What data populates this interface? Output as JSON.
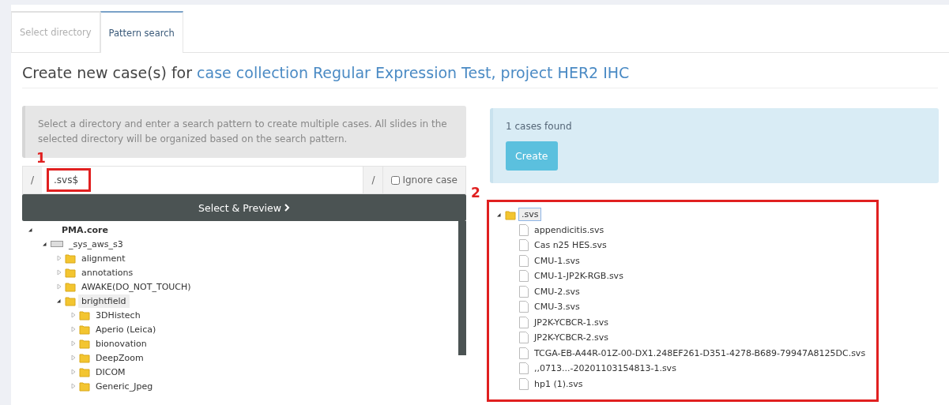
{
  "tabs": [
    {
      "label": "Select directory",
      "selected": false
    },
    {
      "label": "Pattern search",
      "selected": true
    }
  ],
  "heading": {
    "prefix": "Create new case(s) for",
    "link": "case collection Regular Expression Test, project HER2 IHC"
  },
  "info": "Select a directory and enter a search pattern to create multiple cases. All slides in the selected directory will be organized based on the search pattern.",
  "pattern": {
    "open_delimiter": "/",
    "value": ".svs$",
    "close_delimiter": "/",
    "callout": "1"
  },
  "ignore_case": {
    "label": "Ignore case",
    "checked": false
  },
  "preview_button": "Select & Preview",
  "directory_tree": [
    {
      "label": "PMA.core",
      "kind": "root",
      "expanded": true,
      "selected": false,
      "children": [
        {
          "label": "_sys_aws_s3",
          "kind": "drive",
          "expanded": true,
          "selected": false,
          "children": [
            {
              "label": "alignment",
              "kind": "folder",
              "expanded": false,
              "selected": false
            },
            {
              "label": "annotations",
              "kind": "folder",
              "expanded": false,
              "selected": false
            },
            {
              "label": "AWAKE(DO_NOT_TOUCH)",
              "kind": "folder",
              "expanded": false,
              "selected": false
            },
            {
              "label": "brightfield",
              "kind": "folder",
              "expanded": true,
              "selected": true,
              "children": [
                {
                  "label": "3DHistech",
                  "kind": "folder",
                  "expanded": false,
                  "selected": false
                },
                {
                  "label": "Aperio (Leica)",
                  "kind": "folder",
                  "expanded": false,
                  "selected": false
                },
                {
                  "label": "bionovation",
                  "kind": "folder",
                  "expanded": false,
                  "selected": false
                },
                {
                  "label": "DeepZoom",
                  "kind": "folder",
                  "expanded": false,
                  "selected": false
                },
                {
                  "label": "DICOM",
                  "kind": "folder",
                  "expanded": false,
                  "selected": false
                },
                {
                  "label": "Generic_Jpeg",
                  "kind": "folder",
                  "expanded": false,
                  "selected": false
                }
              ]
            }
          ]
        }
      ]
    }
  ],
  "result": {
    "count": "1 cases found",
    "create_button": "Create"
  },
  "result_tree": {
    "callout": "2",
    "items": [
      {
        "label": ".svs",
        "kind": "folder",
        "expanded": true,
        "selected": true,
        "children": [
          {
            "label": "appendicitis.svs",
            "kind": "file",
            "selected": false
          },
          {
            "label": "Cas n25 HES.svs",
            "kind": "file",
            "selected": false
          },
          {
            "label": "CMU-1.svs",
            "kind": "file",
            "selected": false
          },
          {
            "label": "CMU-1-JP2K-RGB.svs",
            "kind": "file",
            "selected": false
          },
          {
            "label": "CMU-2.svs",
            "kind": "file",
            "selected": false
          },
          {
            "label": "CMU-3.svs",
            "kind": "file",
            "selected": false
          },
          {
            "label": "JP2K-YCBCR-1.svs",
            "kind": "file",
            "selected": false
          },
          {
            "label": "JP2K-YCBCR-2.svs",
            "kind": "file",
            "selected": false
          },
          {
            "label": "TCGA-EB-A44R-01Z-00-DX1.248EF261-D351-4278-B689-79947A8125DC.svs",
            "kind": "file",
            "selected": false
          },
          {
            "label": ",,0713...-20201103154813-1.svs",
            "kind": "file",
            "selected": false
          },
          {
            "label": "hp1 (1).svs",
            "kind": "file",
            "selected": false
          }
        ]
      }
    ]
  }
}
